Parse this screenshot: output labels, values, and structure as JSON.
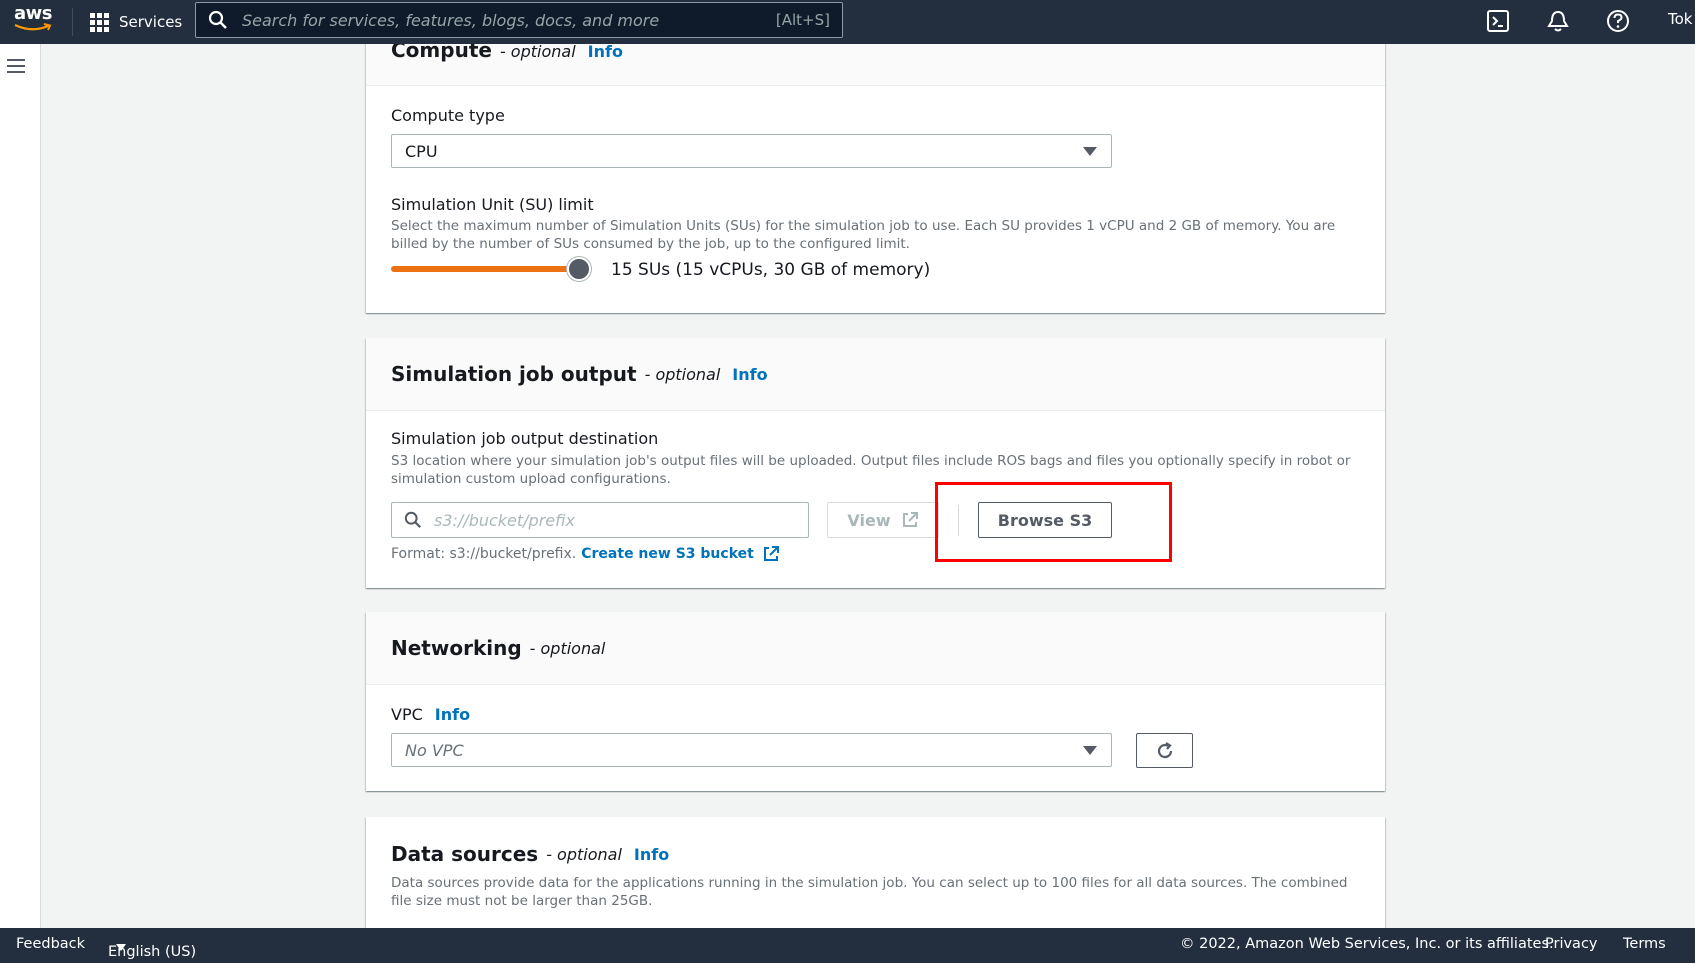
{
  "nav": {
    "logo_text": "aws",
    "services_label": "Services",
    "search_placeholder": "Search for services, features, blogs, docs, and more",
    "search_shortcut": "[Alt+S]",
    "region_label": "Tok",
    "icons": [
      "cloudshell-icon",
      "notifications-bell-icon",
      "help-icon"
    ]
  },
  "compute": {
    "title": "Compute",
    "optional": "- optional",
    "info": "Info",
    "compute_type_label": "Compute type",
    "compute_type_value": "CPU",
    "su_label": "Simulation Unit (SU) limit",
    "su_description": "Select the maximum number of Simulation Units (SUs) for the simulation job to use. Each SU provides 1 vCPU and 2 GB of memory. You are billed by the number of SUs consumed by the job, up to the configured limit.",
    "su_value_text": "15 SUs (15 vCPUs, 30 GB of memory)",
    "su_value": 15
  },
  "output": {
    "title": "Simulation job output",
    "optional": "- optional",
    "info": "Info",
    "dest_label": "Simulation job output destination",
    "dest_description": "S3 location where your simulation job's output files will be uploaded. Output files include ROS bags and files you optionally specify in robot or simulation custom upload configurations.",
    "input_placeholder": "s3://bucket/prefix",
    "view_label": "View",
    "browse_label": "Browse S3",
    "format_hint": "Format: s3://bucket/prefix.",
    "create_bucket_label": "Create new S3 bucket"
  },
  "networking": {
    "title": "Networking",
    "optional": "- optional",
    "vpc_label": "VPC",
    "info": "Info",
    "vpc_placeholder": "No VPC"
  },
  "data_sources": {
    "title": "Data sources",
    "optional": "- optional",
    "info": "Info",
    "description": "Data sources provide data for the applications running in the simulation job. You can select up to 100 files for all data sources. The combined file size must not be larger than 25GB."
  },
  "footer": {
    "feedback": "Feedback",
    "language": "English (US)",
    "copyright": "© 2022, Amazon Web Services, Inc. or its affiliates.",
    "privacy": "Privacy",
    "terms": "Terms"
  },
  "colors": {
    "nav_bg": "#232f3e",
    "link": "#0073bb",
    "slider_fill": "#ec7211",
    "highlight_box": "#ff0000"
  }
}
